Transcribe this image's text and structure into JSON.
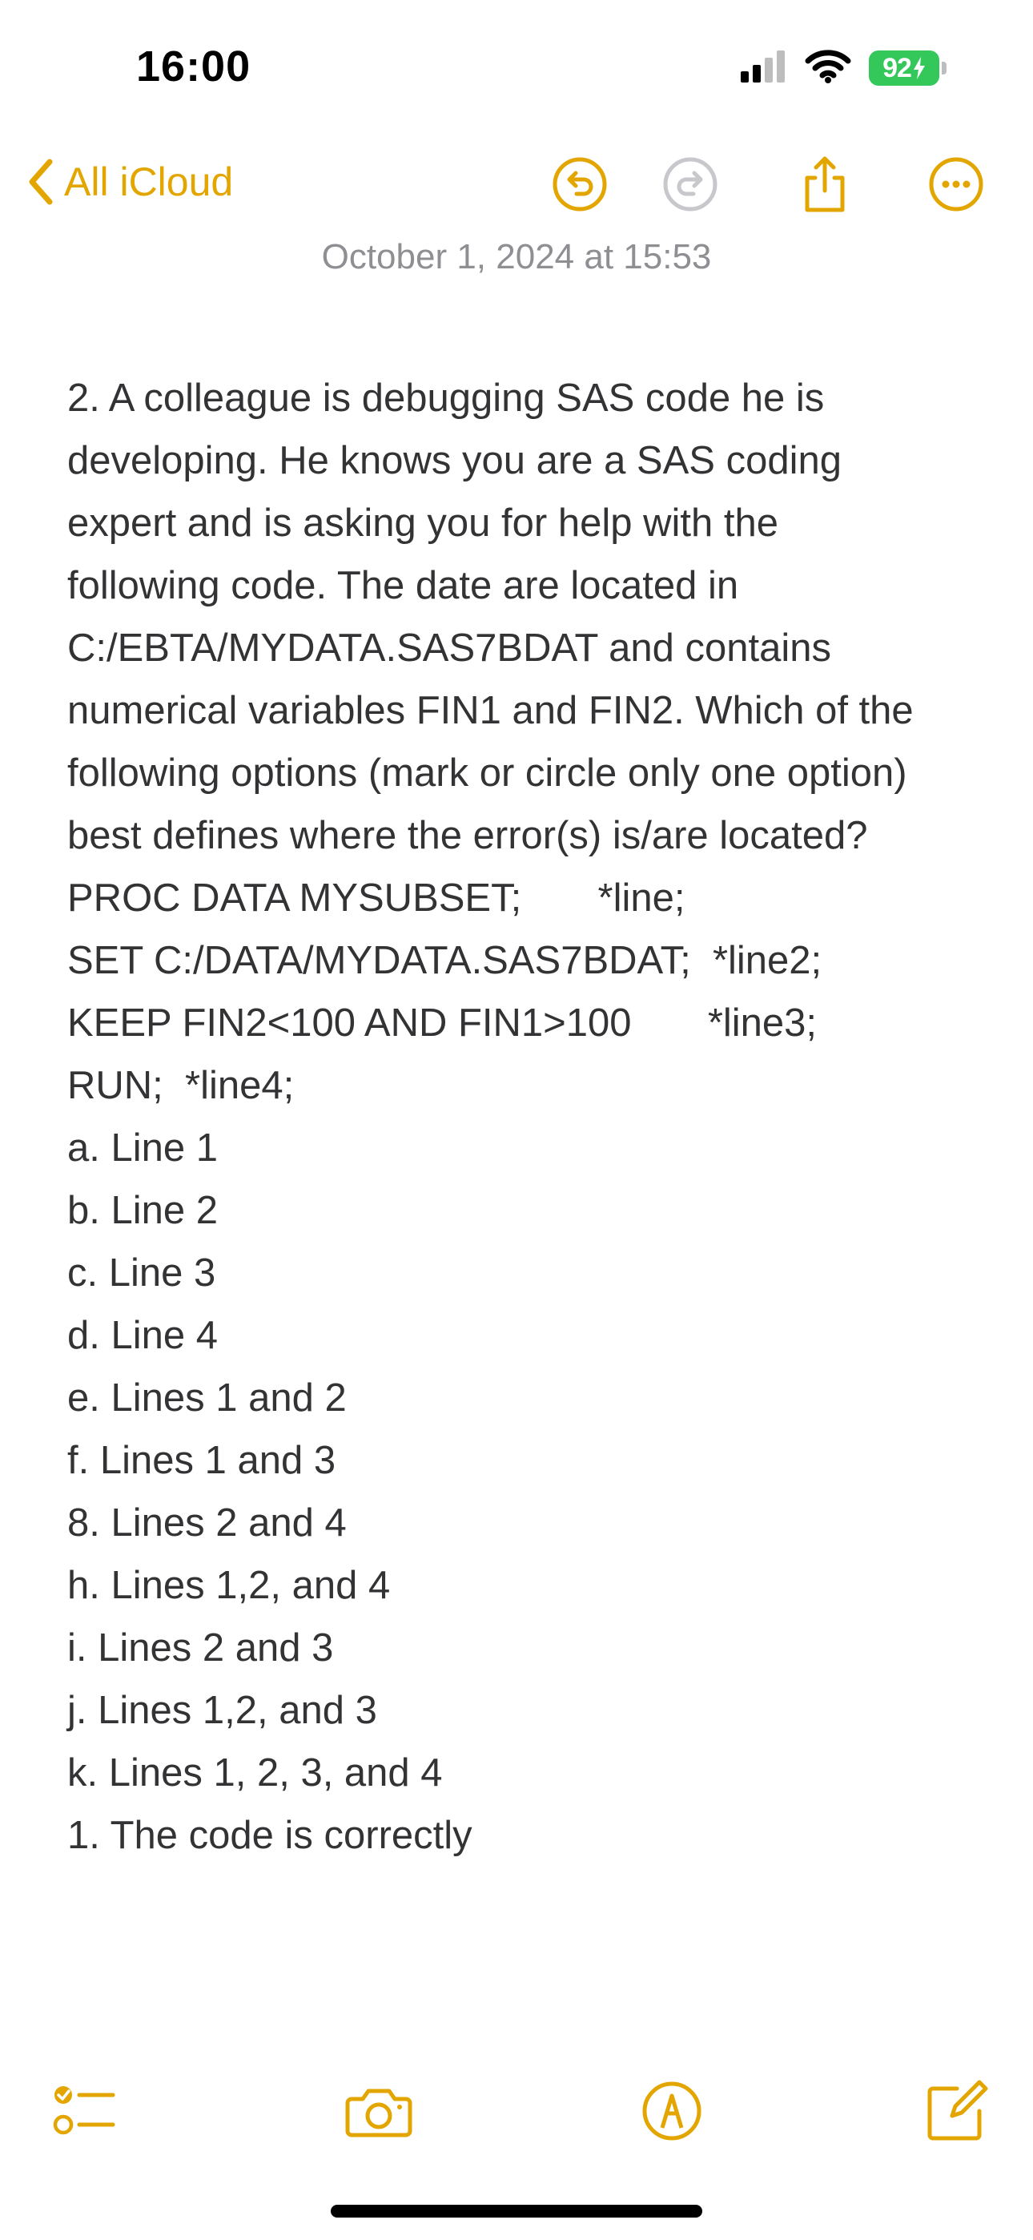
{
  "status_bar": {
    "time": "16:00",
    "battery": "92"
  },
  "nav": {
    "back_label": "All iCloud",
    "icons": [
      "undo-icon",
      "redo-icon",
      "share-icon",
      "more-icon"
    ]
  },
  "note": {
    "date": "October 1, 2024 at 15:53",
    "lines": [
      "2. A colleague is debugging SAS code he is",
      "developing. He knows you are a SAS coding",
      "expert and is asking you for help with the",
      "following code. The date are located in",
      "C:/EBTA/MYDATA.SAS7BDAT and contains",
      "numerical variables FIN1 and FIN2. Which of the",
      "following options (mark or circle only one option)",
      "best defines where the error(s) is/are located?",
      "PROC DATA MYSUBSET;       *line;",
      "SET C:/DATA/MYDATA.SAS7BDAT;  *line2;",
      "KEEP FIN2<100 AND FIN1>100       *line3;",
      "RUN;  *line4;",
      "a. Line 1",
      "b. Line 2",
      "c. Line 3",
      "d. Line 4",
      "e. Lines 1 and 2",
      "f. Lines 1 and 3",
      "8. Lines 2 and 4",
      "h. Lines 1,2, and 4",
      "i. Lines 2 and 3",
      "j. Lines 1,2, and 3",
      "k. Lines 1, 2, 3, and 4",
      "1. The code is correctly"
    ]
  },
  "toolbar": {
    "icons": [
      "checklist-icon",
      "camera-icon",
      "markup-icon",
      "compose-icon"
    ]
  },
  "colors": {
    "accent": "#e3a500",
    "battery": "#34c759",
    "secondary_text": "#8e8e93",
    "body_text": "#333335"
  }
}
